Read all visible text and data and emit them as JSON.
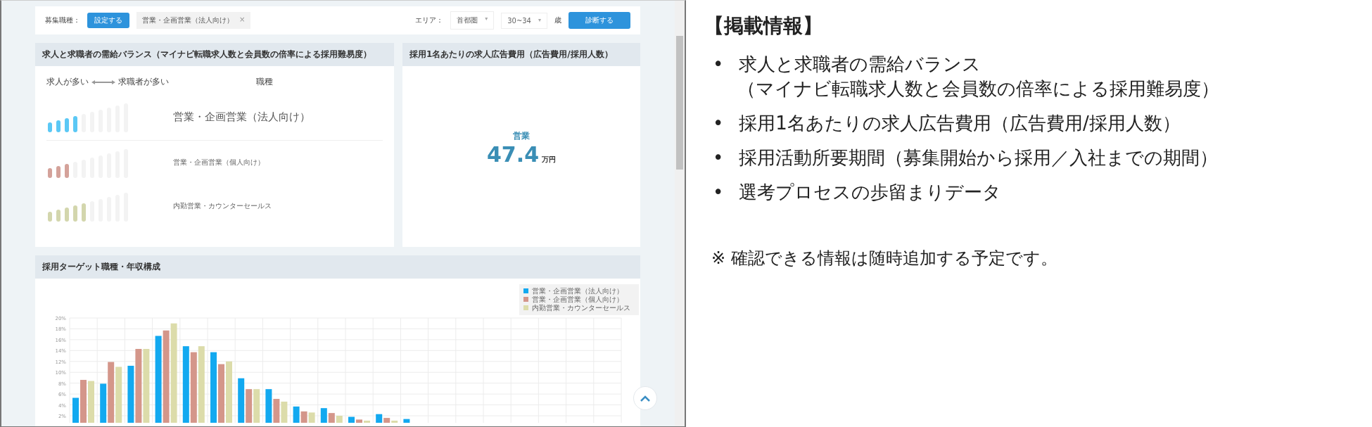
{
  "filter_bar": {
    "job_label": "募集職種：",
    "set_button": "設定する",
    "job_tag": {
      "label": "営業・企画営業（法人向け）",
      "remove": "×"
    },
    "area_label": "エリア：",
    "area_select": {
      "value": "首都圏",
      "caret": "▾"
    },
    "age_select": {
      "value": "30~34",
      "caret": "▾"
    },
    "age_unit": "歳",
    "diagnose_button": "診断する"
  },
  "balance_panel": {
    "title": "求人と求職者の需給バランス（マイナビ転職求人数と会員数の倍率による採用難易度）",
    "legend_left": "求人が多い",
    "legend_right": "求職者が多い",
    "column_heading": "職種",
    "rows": [
      {
        "label": "営業・企画営業（法人向け）",
        "level": 0.4,
        "color": "#5bc8f5",
        "highlighted": true
      },
      {
        "label": "営業・企画営業（個人向け）",
        "level": 0.3,
        "color": "#d4a29a",
        "highlighted": false
      },
      {
        "label": "内勤営業・カウンターセールス",
        "level": 0.5,
        "color": "#d3d6ad",
        "highlighted": false
      }
    ]
  },
  "cost_panel": {
    "title": "採用1名あたりの求人広告費用（広告費用/採用人数）",
    "category": "営業",
    "value": "47.4",
    "unit": "万円"
  },
  "chart_panel": {
    "title": "採用ターゲット職種・年収構成",
    "chart_data": {
      "type": "bar",
      "grid": true,
      "legend": true,
      "ylim": [
        0.7,
        20
      ],
      "yticks": [
        {
          "value": 2,
          "label": "2%"
        },
        {
          "value": 4,
          "label": "4%"
        },
        {
          "value": 6,
          "label": "6%"
        },
        {
          "value": 8,
          "label": "8%"
        },
        {
          "value": 10,
          "label": "10%"
        },
        {
          "value": 12,
          "label": "12%"
        },
        {
          "value": 14,
          "label": "14%"
        },
        {
          "value": 16,
          "label": "16%"
        },
        {
          "value": 18,
          "label": "18%"
        },
        {
          "value": 20,
          "label": "20%"
        }
      ],
      "series": [
        {
          "name": "営業・企画営業（法人向け）",
          "color": "#12a9f0",
          "values": [
            5.3,
            7.9,
            11.2,
            16.7,
            14.8,
            13.7,
            8.9,
            6.9,
            3.7,
            3.4,
            1.8,
            2.3,
            1.4,
            null,
            null,
            null,
            null,
            null,
            null,
            null
          ]
        },
        {
          "name": "営業・企画営業（個人向け）",
          "color": "#d4968a",
          "values": [
            8.6,
            11.9,
            14.3,
            17.7,
            13.7,
            11.5,
            6.9,
            5.1,
            2.8,
            2.5,
            1.3,
            1.6,
            null,
            null,
            null,
            null,
            null,
            null,
            null,
            null
          ]
        },
        {
          "name": "内勤営業・カウンターセールス",
          "color": "#dcdcaa",
          "values": [
            8.4,
            11.0,
            14.3,
            19.0,
            14.8,
            12.0,
            6.9,
            4.6,
            2.6,
            2.0,
            1.1,
            1.1,
            null,
            null,
            null,
            null,
            null,
            null,
            null,
            null
          ]
        }
      ]
    }
  },
  "info": {
    "heading": "【掲載情報】",
    "bullets": [
      {
        "mark": "•",
        "lines": [
          "求人と求職者の需給バランス",
          "（マイナビ転職求人数と会員数の倍率による採用難易度）"
        ]
      },
      {
        "mark": "•",
        "lines": [
          "採用1名あたりの求人広告費用（広告費用/採用人数）"
        ]
      },
      {
        "mark": "•",
        "lines": [
          "採用活動所要期間（募集開始から採用／入社までの期間）"
        ]
      },
      {
        "mark": "•",
        "lines": [
          "選考プロセスの歩留まりデータ"
        ]
      }
    ],
    "note": "※ 確認できる情報は随時追加する予定です。"
  }
}
